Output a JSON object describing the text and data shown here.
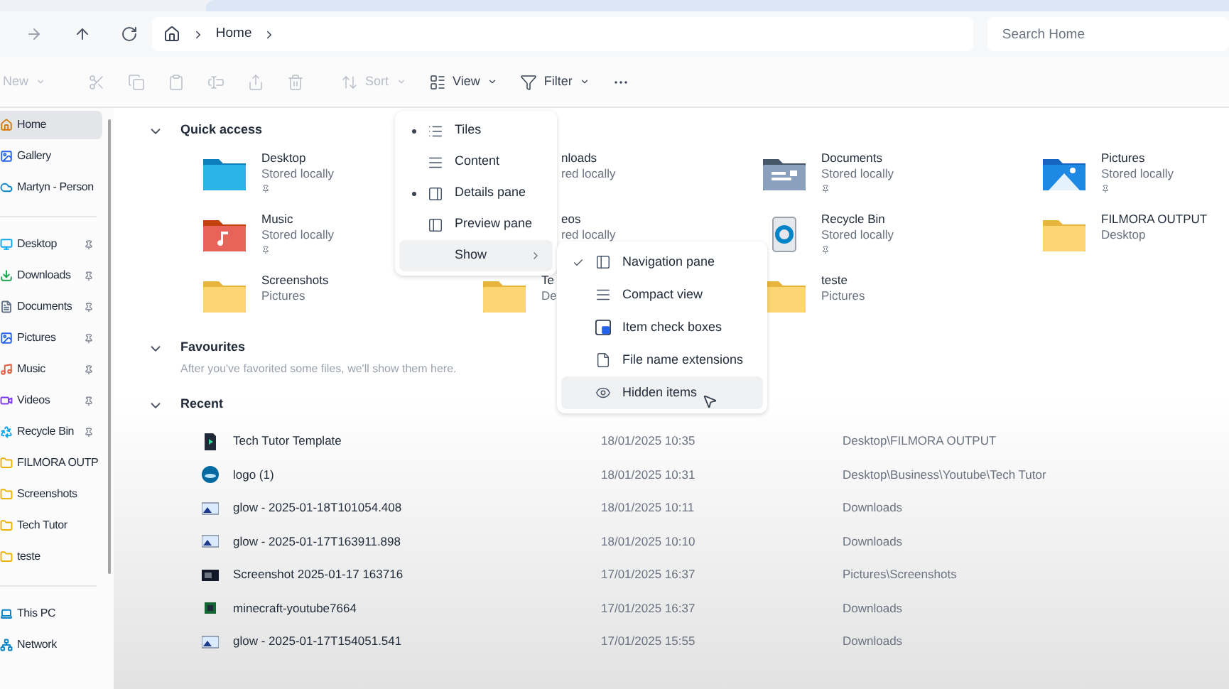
{
  "address_bar": {
    "crumbs": [
      "Home"
    ]
  },
  "search": {
    "placeholder": "Search Home"
  },
  "toolbar": [
    {
      "kind": "new",
      "label": "New",
      "disabled": true
    },
    {
      "kind": "cut",
      "disabled": true
    },
    {
      "kind": "copy",
      "disabled": true
    },
    {
      "kind": "paste",
      "disabled": true
    },
    {
      "kind": "rename",
      "disabled": true
    },
    {
      "kind": "share",
      "disabled": true
    },
    {
      "kind": "delete",
      "disabled": true
    },
    {
      "kind": "sort",
      "label": "Sort",
      "disabled": true
    },
    {
      "kind": "view",
      "label": "View",
      "disabled": false
    },
    {
      "kind": "filter",
      "label": "Filter",
      "disabled": false
    },
    {
      "kind": "more",
      "disabled": false
    }
  ],
  "sidebar": {
    "groups": [
      [
        {
          "label": "Home",
          "kind": "home",
          "selected": true,
          "pinned": false
        },
        {
          "label": "Gallery",
          "kind": "gallery",
          "selected": false,
          "pinned": false
        },
        {
          "label": "Martyn - Person",
          "kind": "cloud",
          "selected": false,
          "pinned": false
        }
      ],
      [
        {
          "label": "Desktop",
          "kind": "desktop",
          "selected": false,
          "pinned": true
        },
        {
          "label": "Downloads",
          "kind": "downloads",
          "selected": false,
          "pinned": true
        },
        {
          "label": "Documents",
          "kind": "documents",
          "selected": false,
          "pinned": true
        },
        {
          "label": "Pictures",
          "kind": "pictures",
          "selected": false,
          "pinned": true
        },
        {
          "label": "Music",
          "kind": "music",
          "selected": false,
          "pinned": true
        },
        {
          "label": "Videos",
          "kind": "videos",
          "selected": false,
          "pinned": true
        },
        {
          "label": "Recycle Bin",
          "kind": "recycle",
          "selected": false,
          "pinned": true
        },
        {
          "label": "FILMORA OUTP",
          "kind": "folder",
          "selected": false,
          "pinned": false
        },
        {
          "label": "Screenshots",
          "kind": "folder",
          "selected": false,
          "pinned": false
        },
        {
          "label": "Tech Tutor",
          "kind": "folder",
          "selected": false,
          "pinned": false
        },
        {
          "label": "teste",
          "kind": "folder",
          "selected": false,
          "pinned": false
        }
      ],
      [
        {
          "label": "This PC",
          "kind": "pc",
          "selected": false,
          "pinned": false
        },
        {
          "label": "Network",
          "kind": "network",
          "selected": false,
          "pinned": false
        }
      ]
    ]
  },
  "quick_access": {
    "title": "Quick access",
    "items": [
      {
        "name": "Desktop",
        "location": "Stored locally",
        "kind": "desktop",
        "pinned": true
      },
      {
        "name": "nloads",
        "location": "red locally",
        "kind": "covered",
        "pinned": false
      },
      {
        "name": "Documents",
        "location": "Stored locally",
        "kind": "documents",
        "pinned": true
      },
      {
        "name": "Pictures",
        "location": "Stored locally",
        "kind": "pictures",
        "pinned": true
      },
      {
        "name": "Music",
        "location": "Stored locally",
        "kind": "music",
        "pinned": true
      },
      {
        "name": "eos",
        "location": "red locally",
        "kind": "covered",
        "pinned": false
      },
      {
        "name": "Recycle Bin",
        "location": "Stored locally",
        "kind": "recycle",
        "pinned": true
      },
      {
        "name": "FILMORA OUTPUT",
        "location": "Desktop",
        "kind": "folder",
        "pinned": false
      },
      {
        "name": "Screenshots",
        "location": "Pictures",
        "kind": "folder",
        "pinned": false
      },
      {
        "name": "Te",
        "location": "De",
        "kind": "folder",
        "pinned": false
      },
      {
        "name": "teste",
        "location": "Pictures",
        "kind": "folder",
        "pinned": false
      }
    ]
  },
  "favourites": {
    "title": "Favourites",
    "empty_text": "After you've favorited some files, we'll show them here."
  },
  "recent": {
    "title": "Recent",
    "rows": [
      {
        "name": "Tech Tutor Template",
        "date": "18/01/2025 10:35",
        "location": "Desktop\\FILMORA OUTPUT",
        "kind": "video"
      },
      {
        "name": "logo (1)",
        "date": "18/01/2025 10:31",
        "location": "Desktop\\Business\\Youtube\\Tech Tutor",
        "kind": "logo"
      },
      {
        "name": "glow - 2025-01-18T101054.408",
        "date": "18/01/2025 10:11",
        "location": "Downloads",
        "kind": "image"
      },
      {
        "name": "glow - 2025-01-17T163911.898",
        "date": "18/01/2025 10:10",
        "location": "Downloads",
        "kind": "image"
      },
      {
        "name": "Screenshot 2025-01-17 163716",
        "date": "17/01/2025 16:37",
        "location": "Pictures\\Screenshots",
        "kind": "screenshot"
      },
      {
        "name": "minecraft-youtube7664",
        "date": "17/01/2025 16:37",
        "location": "Downloads",
        "kind": "minecraft"
      },
      {
        "name": "glow - 2025-01-17T154051.541",
        "date": "17/01/2025 15:55",
        "location": "Downloads",
        "kind": "image"
      }
    ]
  },
  "view_menu": {
    "items": [
      {
        "label": "Tiles",
        "kind": "radio",
        "selected": true
      },
      {
        "label": "Content",
        "kind": "radio",
        "selected": false
      },
      {
        "label": "Details pane",
        "kind": "toggle",
        "checked": true
      },
      {
        "label": "Preview pane",
        "kind": "toggle",
        "checked": false
      },
      {
        "label": "Show",
        "kind": "submenu",
        "highlighted": true
      }
    ]
  },
  "show_menu": {
    "items": [
      {
        "label": "Navigation pane",
        "checked": true,
        "highlighted": false
      },
      {
        "label": "Compact view",
        "checked": false,
        "highlighted": false
      },
      {
        "label": "Item check boxes",
        "checked": false,
        "highlighted": false
      },
      {
        "label": "File name extensions",
        "checked": false,
        "highlighted": false
      },
      {
        "label": "Hidden items",
        "checked": false,
        "highlighted": true
      }
    ]
  }
}
